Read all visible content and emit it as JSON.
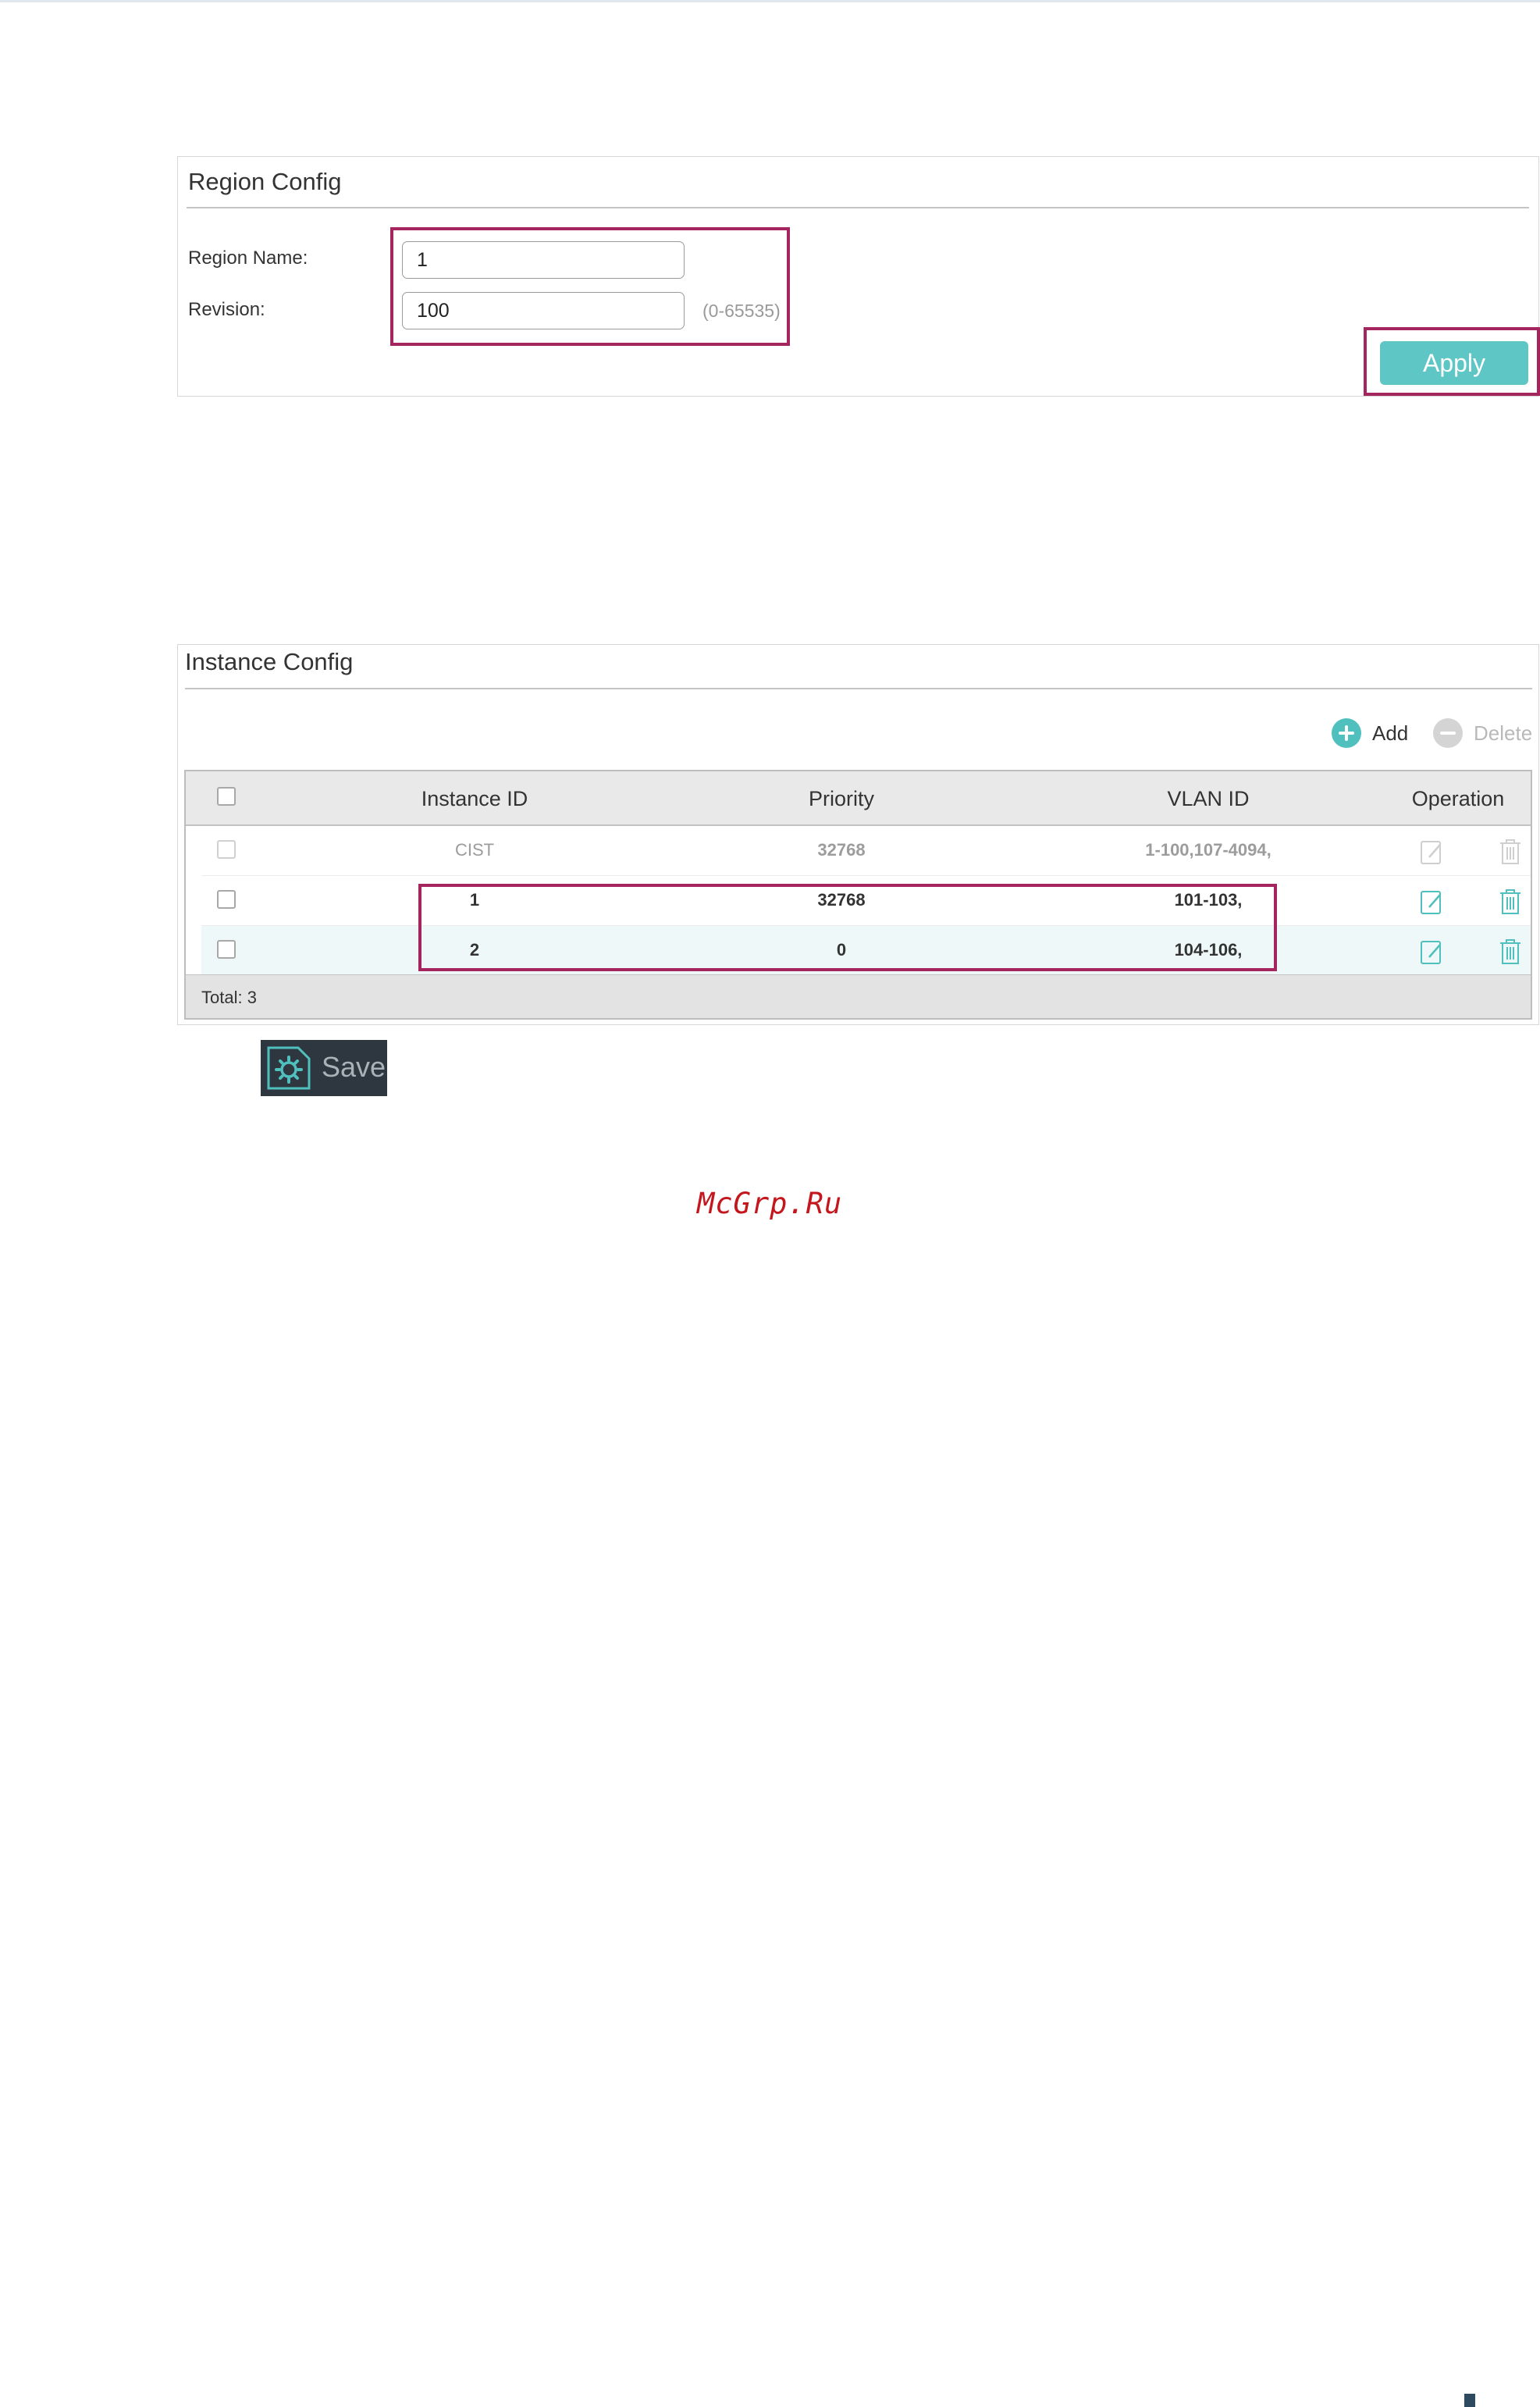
{
  "region_config": {
    "title": "Region Config",
    "region_name_label": "Region Name:",
    "region_name_value": "1",
    "revision_label": "Revision:",
    "revision_value": "100",
    "revision_range": "(0-65535)",
    "apply_label": "Apply"
  },
  "instance_config": {
    "title": "Instance Config",
    "add_label": "Add",
    "delete_label": "Delete",
    "columns": [
      "Instance ID",
      "Priority",
      "VLAN ID",
      "Operation"
    ],
    "rows": [
      {
        "instance_id": "CIST",
        "priority": "32768",
        "vlan_id": "1-100,107-4094,"
      },
      {
        "instance_id": "1",
        "priority": "32768",
        "vlan_id": "101-103,"
      },
      {
        "instance_id": "2",
        "priority": "0",
        "vlan_id": "104-106,"
      }
    ],
    "total": "Total: 3"
  },
  "save": {
    "label": "Save",
    "icon": "save-gear-icon"
  },
  "watermark": "McGrp.Ru",
  "colors": {
    "accent": "#5ec6c4",
    "highlight": "#a5265f",
    "watermark": "#c4161c"
  }
}
